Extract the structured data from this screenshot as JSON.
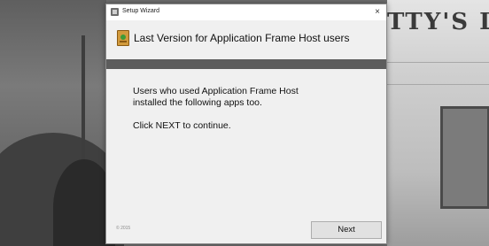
{
  "window": {
    "title": "Setup Wizard",
    "close_label": "×"
  },
  "header": {
    "title": "Last Version for Application Frame Host users"
  },
  "body": {
    "line1": "Users who used Application Frame Host",
    "line2": "installed the following apps too.",
    "line3": "Click NEXT to continue."
  },
  "footer": {
    "copyright": "© 2015",
    "next_label": "Next"
  },
  "background": {
    "sign_text": "TTY'S LA"
  },
  "colors": {
    "divider_bar": "#5c5c5c",
    "dialog_bg": "#f0f0f0",
    "button_bg": "#e1e1e1"
  },
  "icons": {
    "titlebar": "app-icon",
    "header": "installer-box-icon",
    "close": "close-icon"
  }
}
